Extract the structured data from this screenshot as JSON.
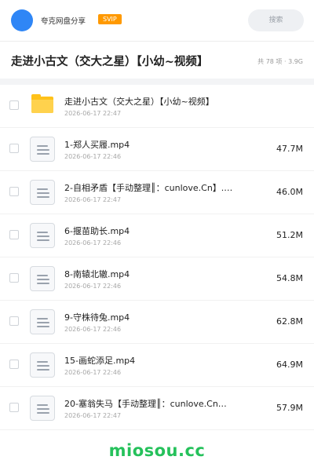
{
  "header": {
    "app_name": "夸克网盘分享",
    "badge": "SVIP",
    "search_label": "搜索"
  },
  "folder": {
    "title": "走进小古文（交大之星）【小幼~视频】",
    "meta": "共 78 项 · 3.9G"
  },
  "items": [
    {
      "name": "走进小古文（交大之星）【小幼~视频】",
      "date": "2026-06-17 22:47",
      "size": "",
      "type": "folder"
    },
    {
      "name": "1-郑人买履.mp4",
      "date": "2026-06-17 22:46",
      "size": "47.7M",
      "type": "file"
    },
    {
      "name": "2-自相矛盾【手动整理║：cunlove.Cn】.…",
      "date": "2026-06-17 22:47",
      "size": "46.0M",
      "type": "file"
    },
    {
      "name": "6-揠苗助长.mp4",
      "date": "2026-06-17 22:46",
      "size": "51.2M",
      "type": "file"
    },
    {
      "name": "8-南辕北辙.mp4",
      "date": "2026-06-17 22:46",
      "size": "54.8M",
      "type": "file"
    },
    {
      "name": "9-守株待兔.mp4",
      "date": "2026-06-17 22:46",
      "size": "62.8M",
      "type": "file"
    },
    {
      "name": "15-画蛇添足.mp4",
      "date": "2026-06-17 22:46",
      "size": "64.9M",
      "type": "file"
    },
    {
      "name": "20-塞翁失马【手动整理║：cunlove.Cn】…",
      "date": "2026-06-17 22:47",
      "size": "57.9M",
      "type": "file"
    }
  ],
  "watermark": "miosou.cc",
  "colors": {
    "avatar": "#2f86f6",
    "badge": "#ff9900",
    "folder": "#ffc21a",
    "watermark": "#25c15b"
  },
  "icons": {
    "folder": "folder-icon",
    "file": "document-icon",
    "search": "search-field"
  }
}
